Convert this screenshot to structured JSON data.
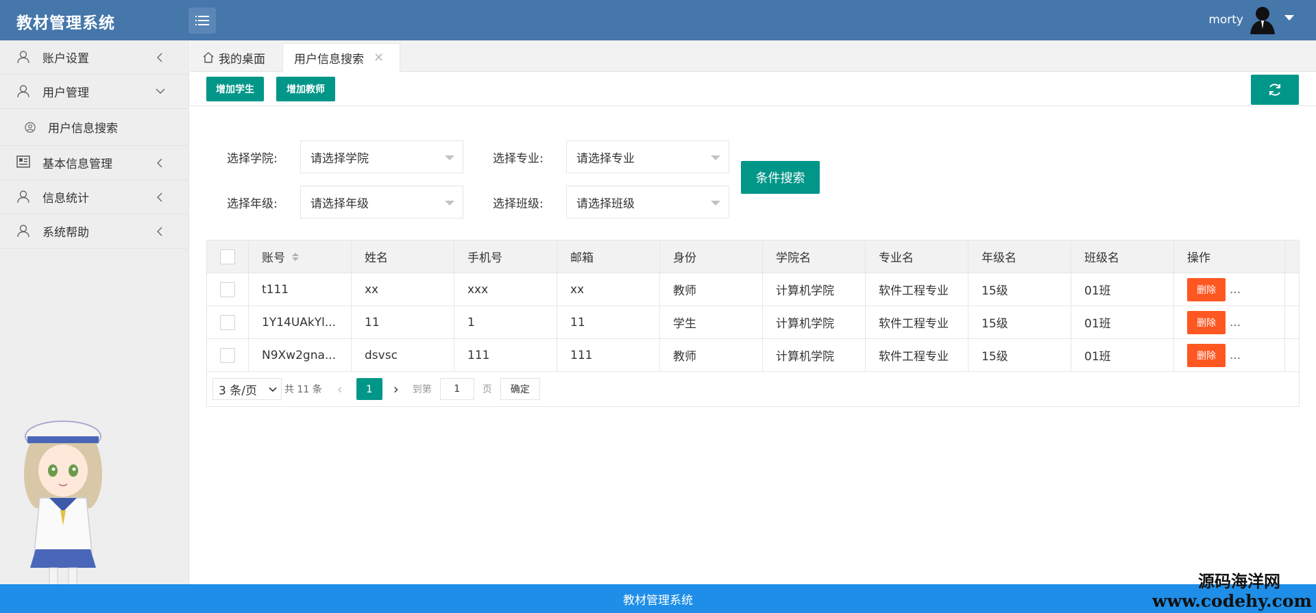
{
  "app": {
    "title": "教材管理系统",
    "user": "morty"
  },
  "sidebar": {
    "items": [
      {
        "label": "账户设置"
      },
      {
        "label": "用户管理"
      },
      {
        "label": "用户信息搜索"
      },
      {
        "label": "基本信息管理"
      },
      {
        "label": "信息统计"
      },
      {
        "label": "系统帮助"
      }
    ]
  },
  "tabs": [
    {
      "label": "我的桌面"
    },
    {
      "label": "用户信息搜索"
    }
  ],
  "toolbar": {
    "add_student": "增加学生",
    "add_teacher": "增加教师"
  },
  "filters": {
    "college_label": "选择学院:",
    "college_value": "请选择学院",
    "major_label": "选择专业:",
    "major_value": "请选择专业",
    "grade_label": "选择年级:",
    "grade_value": "请选择年级",
    "class_label": "选择班级:",
    "class_value": "请选择班级",
    "search_button": "条件搜索"
  },
  "table": {
    "headers": [
      "账号",
      "姓名",
      "手机号",
      "邮箱",
      "身份",
      "学院名",
      "专业名",
      "年级名",
      "班级名",
      "操作"
    ],
    "delete_label": "删除",
    "more_label": "...",
    "rows": [
      [
        "t111",
        "xx",
        "xxx",
        "xx",
        "教师",
        "计算机学院",
        "软件工程专业",
        "15级",
        "01班"
      ],
      [
        "1Y14UAkYl...",
        "11",
        "1",
        "11",
        "学生",
        "计算机学院",
        "软件工程专业",
        "15级",
        "01班"
      ],
      [
        "N9Xw2gna...",
        "dsvsc",
        "111",
        "111",
        "教师",
        "计算机学院",
        "软件工程专业",
        "15级",
        "01班"
      ]
    ]
  },
  "pager": {
    "page_size": "3 条/页",
    "total": "共 11 条",
    "current": "1",
    "goto_label": "到第",
    "goto_value": "1",
    "page_unit": "页",
    "confirm": "确定"
  },
  "footer": {
    "text": "教材管理系统"
  },
  "watermark": {
    "cn": "源码海洋网",
    "url": "www.codehy.com"
  },
  "colors": {
    "header": "#4577ab",
    "primary": "#009688",
    "danger": "#ff5722",
    "footer": "#1e8ee8"
  }
}
